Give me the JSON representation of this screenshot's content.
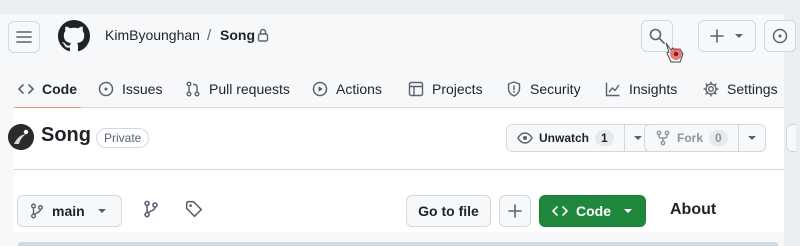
{
  "breadcrumb": {
    "owner": "KimByounghan",
    "separator": "/",
    "repo": "Song"
  },
  "nav": {
    "items": [
      {
        "label": "Code",
        "icon": "code-icon",
        "selected": true
      },
      {
        "label": "Issues",
        "icon": "issue-icon"
      },
      {
        "label": "Pull requests",
        "icon": "pull-request-icon"
      },
      {
        "label": "Actions",
        "icon": "play-icon"
      },
      {
        "label": "Projects",
        "icon": "table-icon"
      },
      {
        "label": "Security",
        "icon": "shield-icon"
      },
      {
        "label": "Insights",
        "icon": "graph-icon"
      },
      {
        "label": "Settings",
        "icon": "gear-icon"
      }
    ]
  },
  "repo": {
    "title": "Song",
    "visibility": "Private",
    "watch": {
      "label": "Unwatch",
      "count": "1"
    },
    "fork": {
      "label": "Fork",
      "count": "0"
    }
  },
  "toolbar": {
    "branch": "main",
    "goto_file": "Go to file",
    "code_button": "Code",
    "about_heading": "About"
  },
  "colors": {
    "accent_underline": "#fd8c73",
    "code_button": "#1f883d",
    "header_bg": "#f6f8fa"
  }
}
